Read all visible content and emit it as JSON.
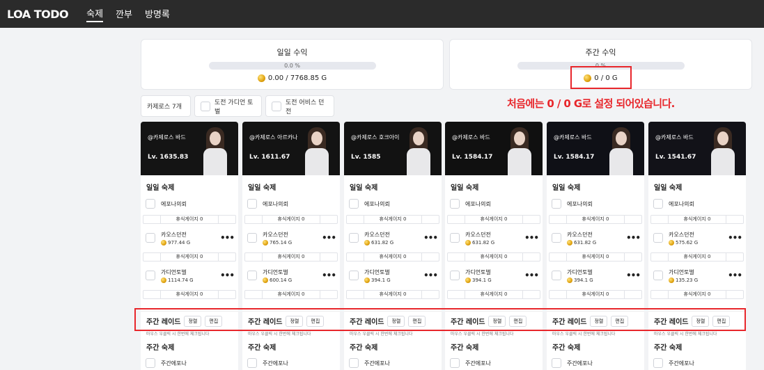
{
  "nav": {
    "logo": "LOA TODO",
    "items": [
      "숙제",
      "깐부",
      "방명록"
    ],
    "active": 0
  },
  "daily_income": {
    "title": "일일 수익",
    "percent": "0.0 %",
    "gold": "0.00 / 7768.85 G"
  },
  "weekly_income": {
    "title": "주간 수익",
    "percent": "0 %",
    "gold": "0 / 0 G"
  },
  "note": "처음에는 0 / 0 G로 설정 되어있습니다.",
  "filters": {
    "count": "카제로스 7개",
    "guardian": "도전 가디언 토벌",
    "abyss": "도전 어비스 던전"
  },
  "labels": {
    "daily_section": "일일 숙제",
    "epona": "에포나의뢰",
    "chaos": "카오스던전",
    "guardian": "가디언토벌",
    "weekly_raid": "주간 레이드",
    "sort": "정렬",
    "edit": "편집",
    "raid_hint": "마우스 우클릭 시 한번에 체크됩니다",
    "weekly_section": "주간 숙제",
    "weekly_epona": "주간에포나"
  },
  "characters": [
    {
      "server": "@카제로스 바드",
      "level": "Lv. 1635.83",
      "rest1": "휴식게이지 0",
      "chaos_gold": "977.44 G",
      "rest2": "휴식게이지 0",
      "guardian_gold": "1114.74 G",
      "rest3": "휴식게이지 0"
    },
    {
      "server": "@카제로스 아르카나",
      "level": "Lv. 1611.67",
      "rest1": "휴식게이지 0",
      "chaos_gold": "765.14 G",
      "rest2": "휴식게이지 0",
      "guardian_gold": "600.14 G",
      "rest3": "휴식게이지 0"
    },
    {
      "server": "@카제로스 호크아이",
      "level": "Lv. 1585",
      "rest1": "휴식게이지 0",
      "chaos_gold": "631.82 G",
      "rest2": "휴식게이지 0",
      "guardian_gold": "394.1 G",
      "rest3": "휴식게이지 0"
    },
    {
      "server": "@카제로스 바드",
      "level": "Lv. 1584.17",
      "rest1": "휴식게이지 0",
      "chaos_gold": "631.82 G",
      "rest2": "휴식게이지 0",
      "guardian_gold": "394.1 G",
      "rest3": "휴식게이지 0"
    },
    {
      "server": "@카제로스 바드",
      "level": "Lv. 1584.17",
      "rest1": "휴식게이지 0",
      "chaos_gold": "631.82 G",
      "rest2": "휴식게이지 0",
      "guardian_gold": "394.1 G",
      "rest3": "휴식게이지 0"
    },
    {
      "server": "@카제로스 바드",
      "level": "Lv. 1541.67",
      "rest1": "휴식게이지 0",
      "chaos_gold": "575.62 G",
      "rest2": "휴식게이지 0",
      "guardian_gold": "135.23 G",
      "rest3": "휴식게이지 0"
    }
  ]
}
